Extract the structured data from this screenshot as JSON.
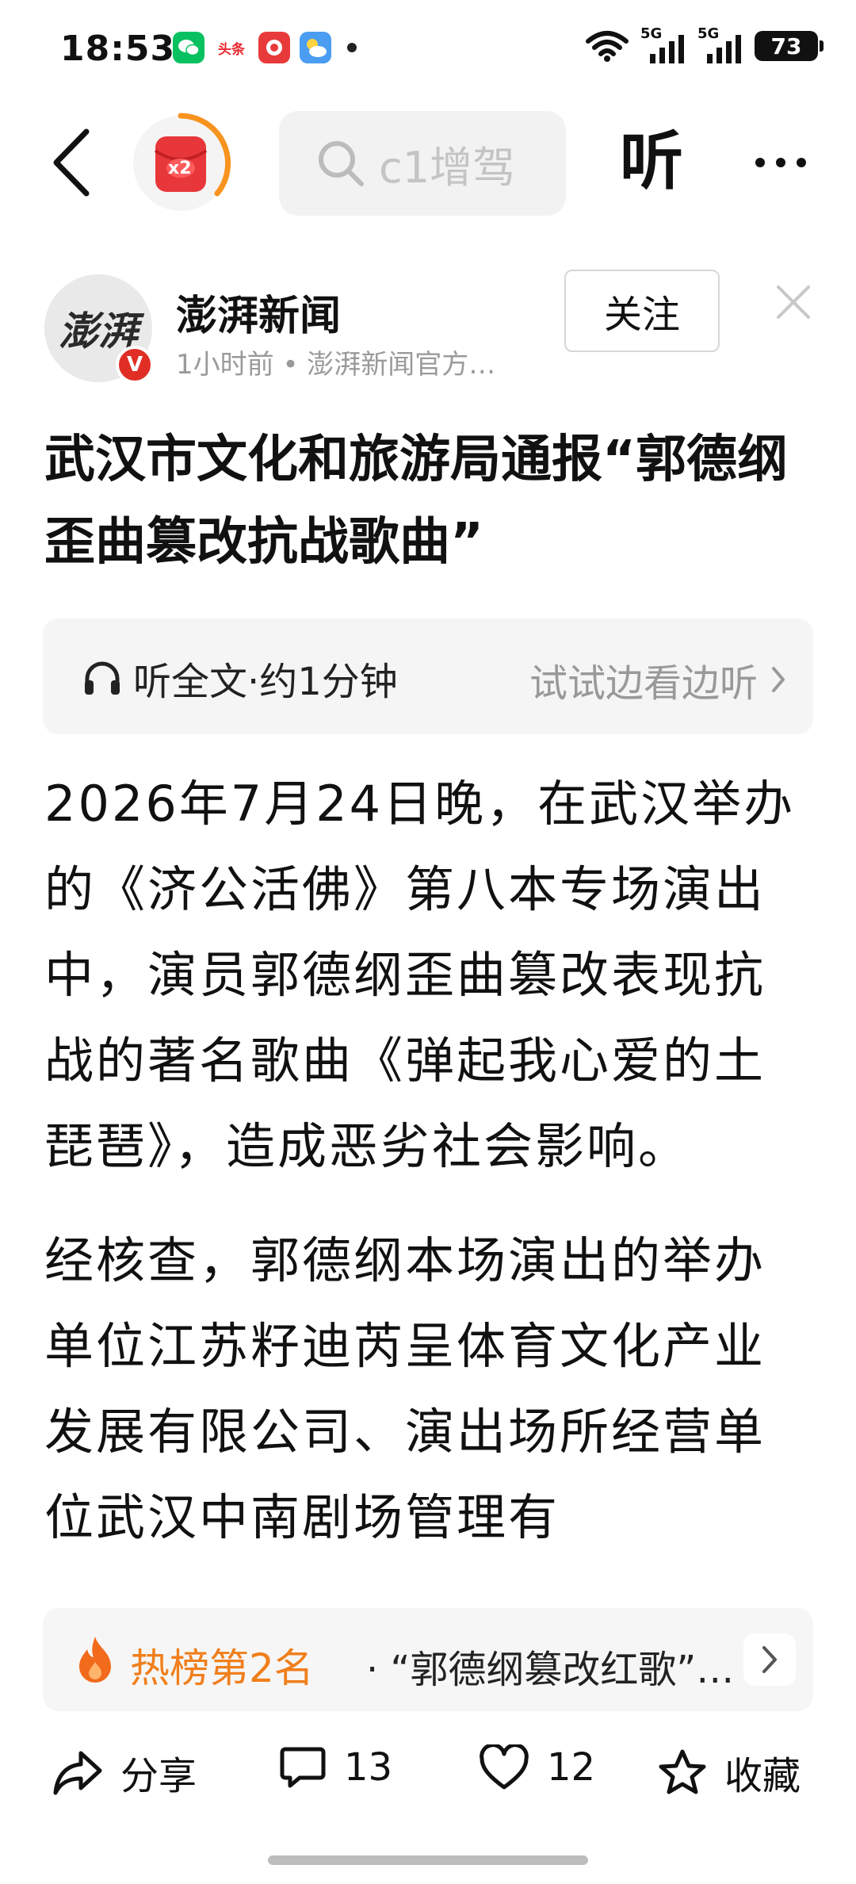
{
  "status_bar": {
    "time": "18:53",
    "app_icons": [
      "wechat-icon",
      "toutiao-icon",
      "news-app-icon",
      "weather-icon"
    ],
    "toutiao_label": "头条",
    "network_1": "5G",
    "network_2": "5G",
    "battery": "73"
  },
  "nav": {
    "reward_badge": "x2",
    "search_placeholder": "c1增驾",
    "listen_label": "听"
  },
  "author": {
    "avatar_text": "澎湃",
    "verified_mark": "V",
    "name": "澎湃新闻",
    "meta": "1小时前 • 澎湃新闻官方…",
    "follow_label": "关注"
  },
  "article": {
    "title": "武汉市文化和旅游局通报“郭德纲歪曲篡改抗战歌曲”",
    "listen_full": "听全文·约1分钟",
    "listen_try": "试试边看边听",
    "paragraphs": [
      "2026年7月24日晚，在武汉举办的《济公活佛》第八本专场演出中，演员郭德纲歪曲篡改表现抗战的著名歌曲《弹起我心爱的土琵琶》，造成恶劣社会影响。",
      "经核查，郭德纲本场演出的举办单位江苏籽迪芮呈体育文化产业发展有限公司、演出场所经营单位武汉中南剧场管理有"
    ]
  },
  "hot": {
    "rank": "热榜第2名",
    "text": "· “郭德纲篡改红歌”…"
  },
  "actions": {
    "share": "分享",
    "comments": "13",
    "likes": "12",
    "favorite": "收藏"
  },
  "colors": {
    "accent_orange": "#f07f1c",
    "verified_red": "#e02e24"
  }
}
